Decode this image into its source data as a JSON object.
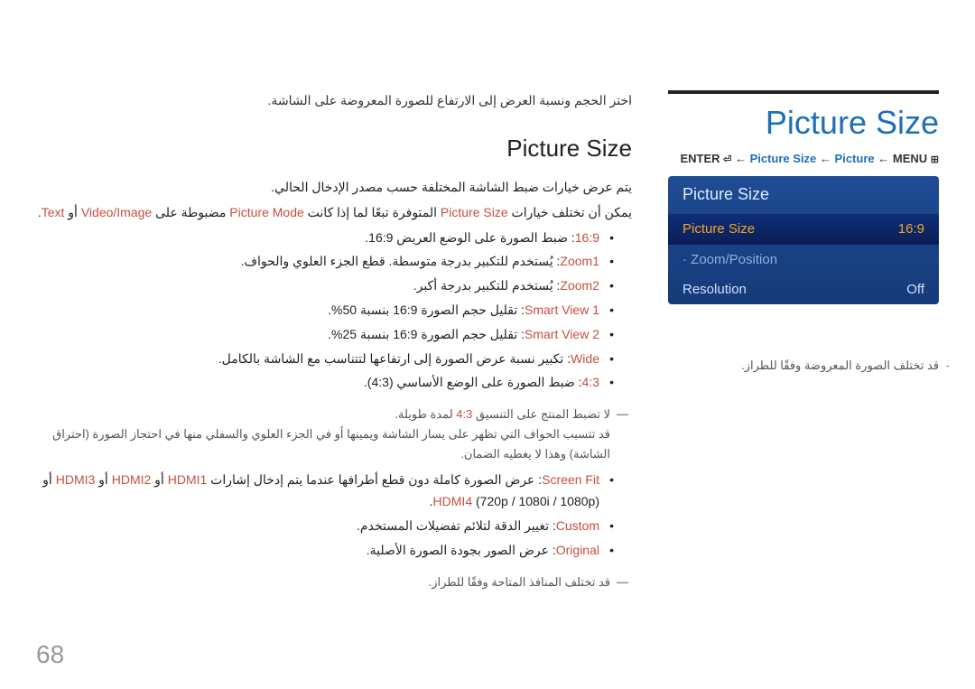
{
  "title_en": "Picture Size",
  "breadcrumb": {
    "enter": "ENTER",
    "enter_icon": "⏎",
    "arrow": "←",
    "a_text": "Picture Size",
    "b_text": "Picture",
    "c_text": "MENU",
    "menu_icon": "⊞"
  },
  "menu": {
    "header": "Picture Size",
    "items": [
      {
        "label": "Picture Size",
        "value": "16:9",
        "selected": true
      },
      {
        "label": "· Zoom/Position",
        "value": "",
        "dim": true
      },
      {
        "label": "Resolution",
        "value": "Off"
      }
    ]
  },
  "note_right": "قد تختلف الصورة المعروضة وفقًا للطراز.",
  "left": {
    "intro": "اختر الحجم ونسبة العرض إلى الارتفاع للصورة المعروضة على الشاشة.",
    "subheading": "Picture Size",
    "p1": "يتم عرض خيارات ضبط الشاشة المختلفة حسب مصدر الإدخال الحالي.",
    "p2_prefix": "يمكن أن تختلف خيارات ",
    "p2_ps": "Picture Size",
    "p2_mid": " المتوفرة تبعًا لما إذا كانت ",
    "p2_pm": "Picture Mode",
    "p2_mid2": " مضبوطة على ",
    "p2_vi": "Video/Image",
    "p2_or": " أو ",
    "p2_txt": "Text",
    "p2_end": ".",
    "li_169_label": "16:9",
    "li_169_text": ": ضبط الصورة على الوضع العريض 16:9.",
    "li_z1_label": "Zoom1",
    "li_z1_text": ": يُستخدم للتكبير بدرجة متوسطة. قطع الجزء العلوي والحواف.",
    "li_z2_label": "Zoom2",
    "li_z2_text": ": يُستخدم للتكبير بدرجة أكبر.",
    "li_sv1_label": "Smart View 1",
    "li_sv1_text": ": تقليل حجم الصورة 16:9 بنسبة 50%.",
    "li_sv2_label": "Smart View 2",
    "li_sv2_text": ": تقليل حجم الصورة 16:9 بنسبة 25%.",
    "li_wide_label": "Wide",
    "li_wide_text": ": تكبير نسبة عرض الصورة إلى ارتفاعها لتتناسب مع الشاشة بالكامل.",
    "li_43_label": "4:3",
    "li_43_text": ": ضبط الصورة على الوضع الأساسي (4:3).",
    "note43_a": "لا تضبط المنتج على التنسيق ",
    "note43_b": "4:3",
    "note43_c": " لمدة طويلة.",
    "note43_d": "قد تتسبب الحواف التي تظهر على يسار الشاشة ويمينها أو في الجزء العلوي والسفلي منها في احتجاز الصورة (احتراق الشاشة) وهذا لا يغطيه الضمان.",
    "li_sf_label": "Screen Fit",
    "li_sf_text": ": عرض الصورة كاملة دون قطع أطرافها عندما يتم إدخال إشارات ",
    "sf_h1": "HDMI1",
    "sf_or1": " أو ",
    "sf_h2": "HDMI2",
    "sf_or2": " أو ",
    "sf_h3": "HDMI3",
    "sf_or3": " أو ",
    "sf_h4": "HDMI4",
    "sf_res": " (720p / 1080i / 1080p).",
    "li_cust_label": "Custom",
    "li_cust_text": ": تغيير الدقة لتلائم تفضيلات المستخدم.",
    "li_orig_label": "Original",
    "li_orig_text": ": عرض الصور بجودة الصورة الأصلية.",
    "bottom_note": "قد تختلف المنافذ المتاحة وفقًا للطراز."
  },
  "page_number": "68"
}
